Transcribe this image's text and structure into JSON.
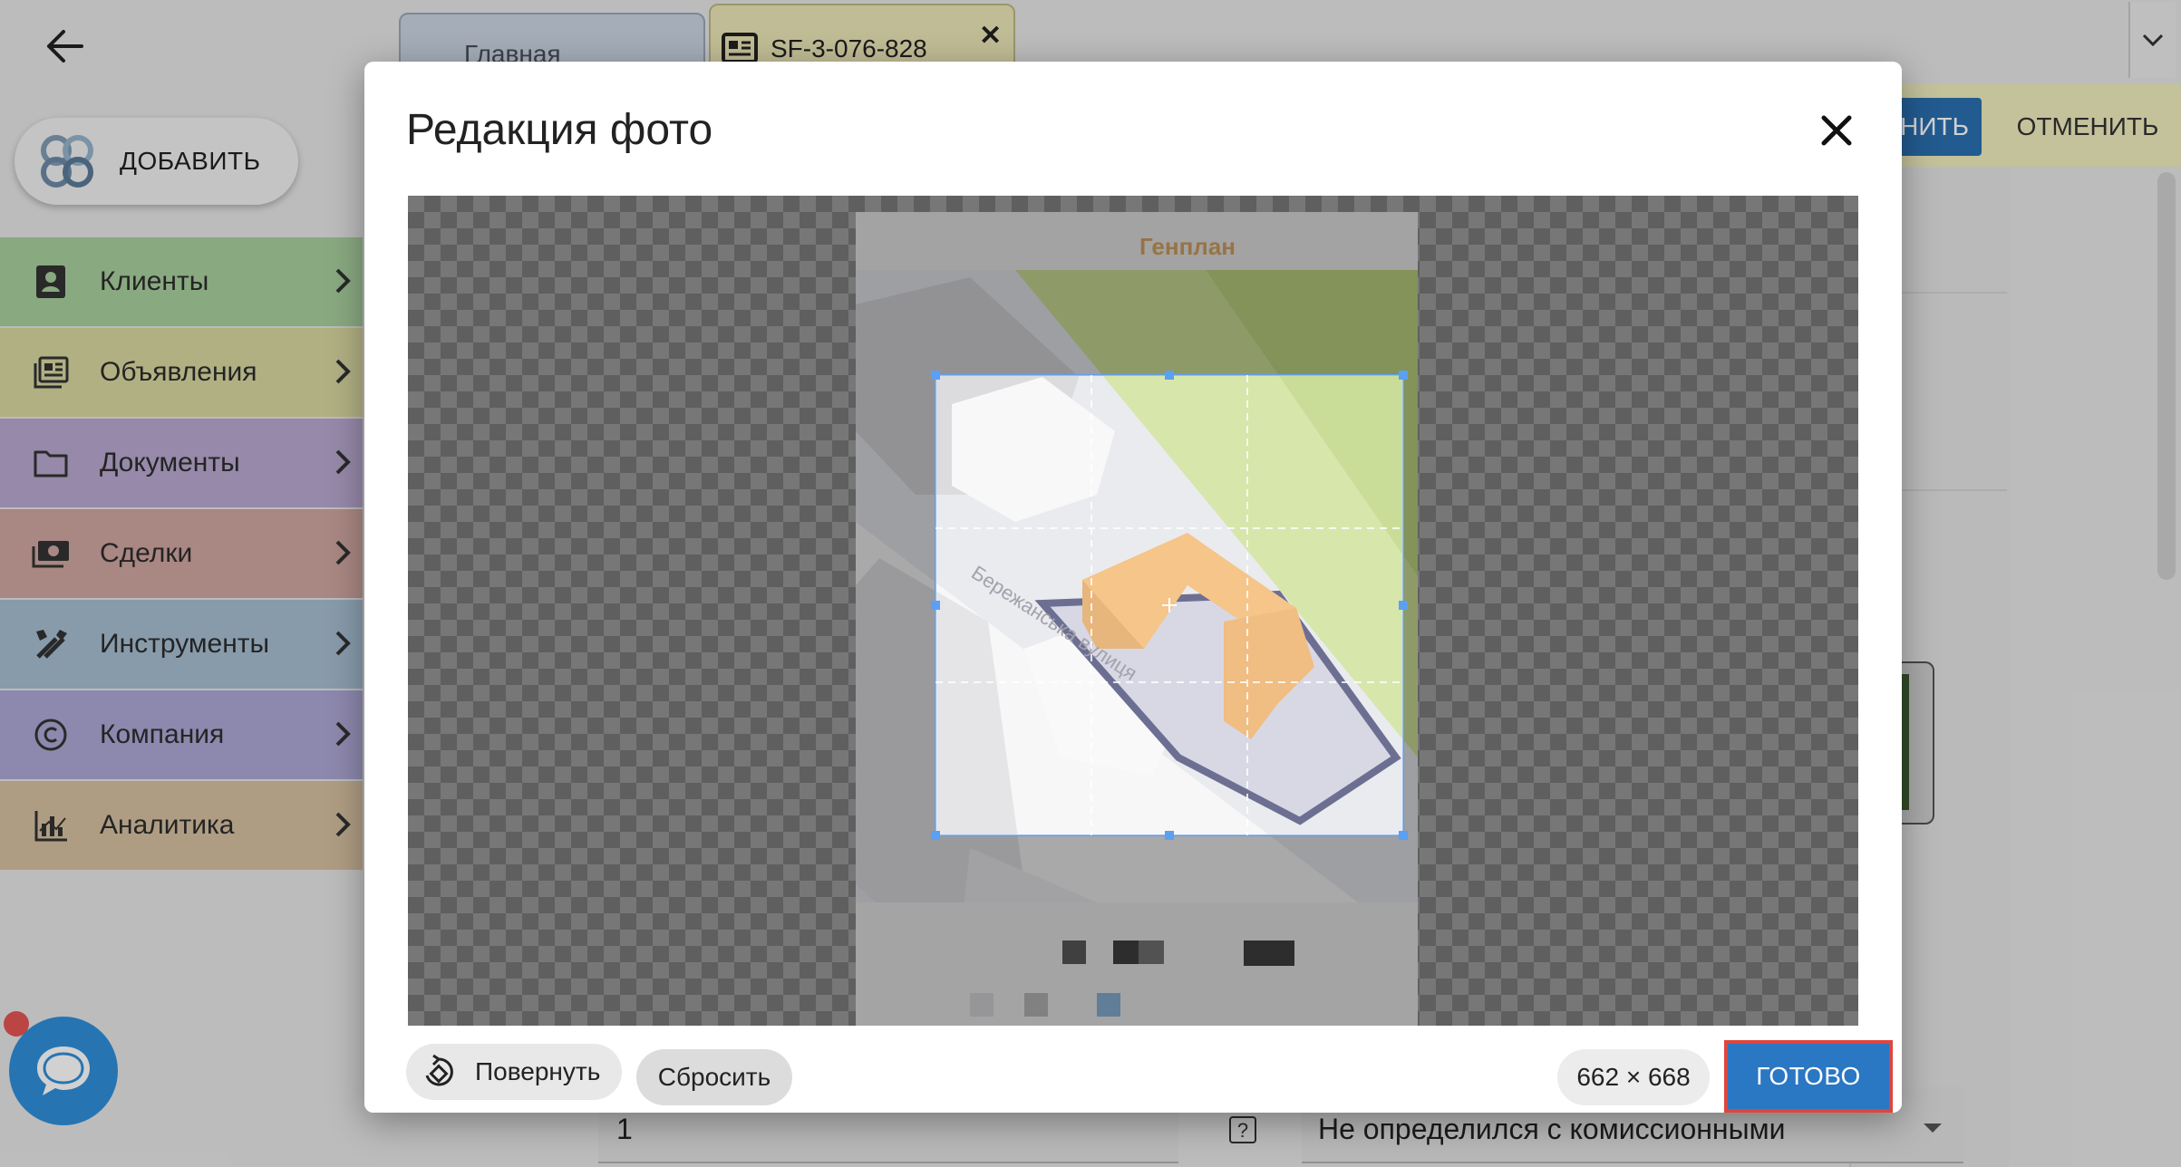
{
  "header": {
    "add_button_label": "ДОБАВИТЬ"
  },
  "tabs": [
    {
      "label": "Главная"
    },
    {
      "label": "SF-3-076-828"
    }
  ],
  "sidebar": {
    "items": [
      {
        "label": "Клиенты",
        "icon": "contacts-icon",
        "color": "#a8cf9e"
      },
      {
        "label": "Объявления",
        "icon": "listing-icon",
        "color": "#d8d7a0"
      },
      {
        "label": "Документы",
        "icon": "folder-icon",
        "color": "#b8a8cf"
      },
      {
        "label": "Сделки",
        "icon": "money-icon",
        "color": "#cfa5a0"
      },
      {
        "label": "Инструменты",
        "icon": "tools-icon",
        "color": "#a6bdd1"
      },
      {
        "label": "Компания",
        "icon": "copyright-icon",
        "color": "#ada7d4"
      },
      {
        "label": "Аналитика",
        "icon": "analytics-icon",
        "color": "#d6c0a0"
      }
    ]
  },
  "toolbar": {
    "save_label_partial": "НИТЬ",
    "cancel_label": "ОТМЕНИТЬ"
  },
  "form": {
    "quantity_value": "1",
    "help_label": "?",
    "commission_value": "Не определился с комиссионными"
  },
  "modal": {
    "title": "Редакция фото",
    "image": {
      "caption": "Генплан",
      "street_label": "Бережанська вулиця"
    },
    "footer": {
      "rotate_label": "Повернуть",
      "reset_label": "Сбросить",
      "dimensions": "662 × 668",
      "done_label": "ГОТОВО"
    }
  },
  "colors": {
    "accent_blue": "#2a77c3",
    "highlight_red": "#e0453c",
    "building_orange": "#f0a64a"
  }
}
